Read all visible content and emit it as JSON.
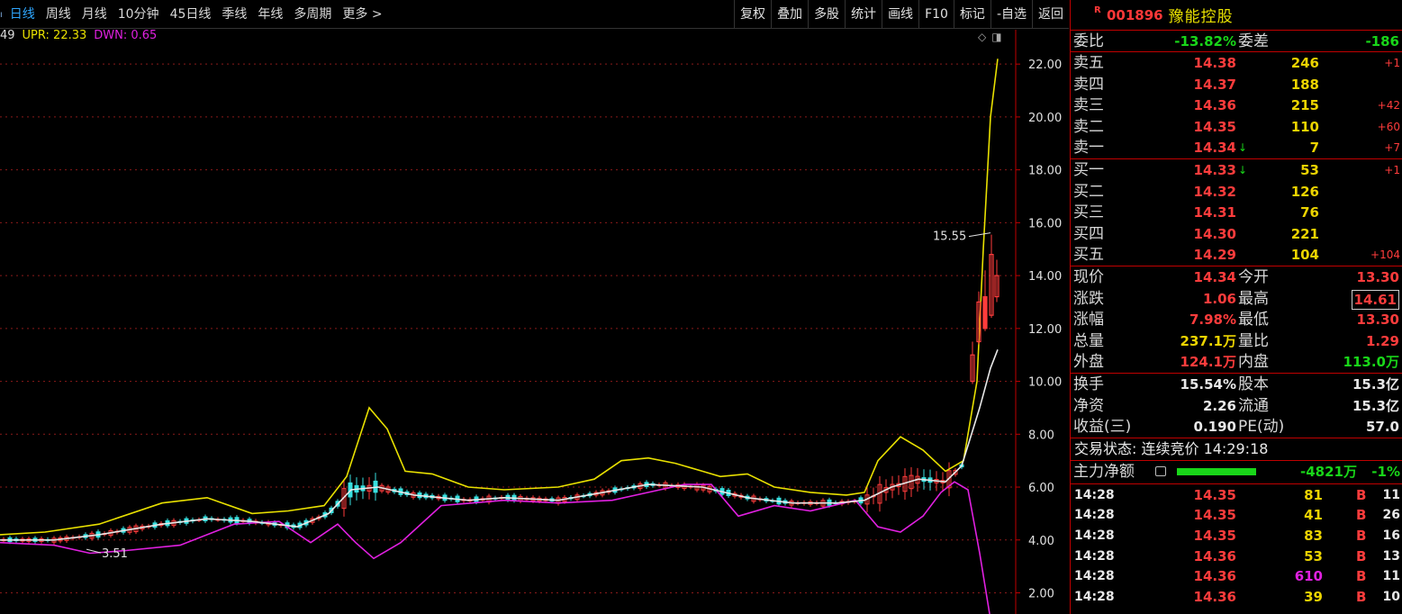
{
  "toolbar": {
    "edge_mark": "ו",
    "period_tabs": [
      {
        "label": "日线",
        "active": true
      },
      {
        "label": "周线",
        "active": false
      },
      {
        "label": "月线",
        "active": false
      },
      {
        "label": "10分钟",
        "active": false
      },
      {
        "label": "45日线",
        "active": false
      },
      {
        "label": "季线",
        "active": false
      },
      {
        "label": "年线",
        "active": false
      },
      {
        "label": "多周期",
        "active": false
      },
      {
        "label": "更多 >",
        "active": false
      }
    ],
    "buttons": [
      "复权",
      "叠加",
      "多股",
      "统计",
      "画线",
      "F10",
      "标记",
      "-自选",
      "返回"
    ]
  },
  "indicator": {
    "prefix": "49",
    "upr": "UPR: 22.33",
    "dwn": "DWN: 0.65",
    "ctrl_icons": [
      "diamond-icon",
      "window-icon"
    ]
  },
  "chart_data": {
    "type": "candlestick",
    "y_axis": {
      "ticks": [
        2.0,
        4.0,
        6.0,
        8.0,
        10.0,
        12.0,
        14.0,
        16.0,
        18.0,
        20.0,
        22.0
      ],
      "tick_labels": [
        "2.00",
        "4.00",
        "6.00",
        "8.00",
        "10.00",
        "12.00",
        "14.00",
        "16.00",
        "18.00",
        "20.00",
        "22.00"
      ],
      "range": [
        1.2,
        23.3
      ]
    },
    "grid": "dotted",
    "annotations": [
      {
        "label": "15.55",
        "value": 15.55,
        "kind": "high-marker"
      },
      {
        "label": "3.51",
        "value": 3.51,
        "kind": "low-marker"
      }
    ],
    "series": [
      {
        "name": "UPR",
        "color": "#e8e000",
        "values": [
          [
            0,
            4.2
          ],
          [
            50,
            4.3
          ],
          [
            110,
            4.6
          ],
          [
            180,
            5.4
          ],
          [
            230,
            5.6
          ],
          [
            280,
            5.0
          ],
          [
            320,
            5.1
          ],
          [
            360,
            5.3
          ],
          [
            385,
            6.4
          ],
          [
            410,
            9.0
          ],
          [
            430,
            8.2
          ],
          [
            450,
            6.6
          ],
          [
            480,
            6.5
          ],
          [
            520,
            6.0
          ],
          [
            560,
            5.9
          ],
          [
            620,
            6.0
          ],
          [
            660,
            6.3
          ],
          [
            690,
            7.0
          ],
          [
            720,
            7.1
          ],
          [
            750,
            6.9
          ],
          [
            780,
            6.6
          ],
          [
            800,
            6.4
          ],
          [
            830,
            6.5
          ],
          [
            860,
            6.0
          ],
          [
            900,
            5.8
          ],
          [
            940,
            5.7
          ],
          [
            960,
            5.8
          ],
          [
            975,
            7.0
          ],
          [
            1000,
            7.9
          ],
          [
            1025,
            7.4
          ],
          [
            1050,
            6.6
          ],
          [
            1070,
            7.0
          ],
          [
            1085,
            10.0
          ],
          [
            1092,
            15.0
          ],
          [
            1100,
            20.0
          ],
          [
            1108,
            22.2
          ]
        ]
      },
      {
        "name": "MID",
        "color": "#e8e8e8",
        "values": [
          [
            0,
            4.0
          ],
          [
            60,
            4.0
          ],
          [
            110,
            4.2
          ],
          [
            180,
            4.6
          ],
          [
            230,
            4.8
          ],
          [
            280,
            4.7
          ],
          [
            330,
            4.5
          ],
          [
            365,
            5.0
          ],
          [
            390,
            5.9
          ],
          [
            420,
            6.0
          ],
          [
            460,
            5.7
          ],
          [
            520,
            5.5
          ],
          [
            560,
            5.6
          ],
          [
            620,
            5.5
          ],
          [
            670,
            5.8
          ],
          [
            720,
            6.1
          ],
          [
            780,
            6.0
          ],
          [
            830,
            5.6
          ],
          [
            880,
            5.4
          ],
          [
            930,
            5.4
          ],
          [
            960,
            5.5
          ],
          [
            990,
            6.0
          ],
          [
            1020,
            6.3
          ],
          [
            1050,
            6.2
          ],
          [
            1068,
            6.8
          ],
          [
            1088,
            9.0
          ],
          [
            1100,
            10.5
          ],
          [
            1108,
            11.2
          ]
        ]
      },
      {
        "name": "DWN",
        "color": "#e020e0",
        "values": [
          [
            0,
            3.9
          ],
          [
            60,
            3.8
          ],
          [
            100,
            3.5
          ],
          [
            140,
            3.6
          ],
          [
            200,
            3.8
          ],
          [
            260,
            4.6
          ],
          [
            310,
            4.7
          ],
          [
            345,
            3.9
          ],
          [
            375,
            4.6
          ],
          [
            395,
            3.9
          ],
          [
            415,
            3.3
          ],
          [
            445,
            3.9
          ],
          [
            490,
            5.3
          ],
          [
            560,
            5.5
          ],
          [
            620,
            5.4
          ],
          [
            680,
            5.5
          ],
          [
            720,
            5.8
          ],
          [
            760,
            6.1
          ],
          [
            790,
            6.1
          ],
          [
            820,
            4.9
          ],
          [
            860,
            5.3
          ],
          [
            900,
            5.1
          ],
          [
            950,
            5.5
          ],
          [
            975,
            4.5
          ],
          [
            1000,
            4.3
          ],
          [
            1025,
            4.9
          ],
          [
            1045,
            5.8
          ],
          [
            1060,
            6.2
          ],
          [
            1075,
            5.9
          ],
          [
            1088,
            3.5
          ],
          [
            1100,
            1.0
          ]
        ]
      },
      {
        "name": "candles",
        "values": [
          {
            "x": 1080,
            "o": 10.0,
            "c": 11.0,
            "h": 11.5,
            "l": 9.9,
            "up": true
          },
          {
            "x": 1087,
            "o": 11.5,
            "c": 13.0,
            "h": 13.4,
            "l": 11.4,
            "up": true
          },
          {
            "x": 1094,
            "o": 13.2,
            "c": 12.0,
            "h": 14.2,
            "l": 11.9,
            "up": false
          },
          {
            "x": 1101,
            "o": 12.5,
            "c": 14.8,
            "h": 15.55,
            "l": 12.4,
            "up": true
          },
          {
            "x": 1107,
            "o": 14.0,
            "c": 13.2,
            "h": 14.6,
            "l": 13.0,
            "up": true
          }
        ]
      }
    ]
  },
  "panel": {
    "r_mark": "R",
    "code": "001896",
    "name": "豫能控股",
    "weibi": {
      "label": "委比",
      "value": "-13.82%",
      "label2": "委差",
      "value2": "-186"
    },
    "asks": [
      {
        "label": "卖五",
        "price": "14.38",
        "vol": "246",
        "chg": "+1"
      },
      {
        "label": "卖四",
        "price": "14.37",
        "vol": "188",
        "chg": ""
      },
      {
        "label": "卖三",
        "price": "14.36",
        "vol": "215",
        "chg": "+42"
      },
      {
        "label": "卖二",
        "price": "14.35",
        "vol": "110",
        "chg": "+60"
      },
      {
        "label": "卖一",
        "price": "14.34",
        "vol": "7",
        "chg": "+7",
        "arrow": "↓"
      }
    ],
    "bids": [
      {
        "label": "买一",
        "price": "14.33",
        "vol": "53",
        "chg": "+1",
        "arrow": "↓"
      },
      {
        "label": "买二",
        "price": "14.32",
        "vol": "126",
        "chg": ""
      },
      {
        "label": "买三",
        "price": "14.31",
        "vol": "76",
        "chg": ""
      },
      {
        "label": "买四",
        "price": "14.30",
        "vol": "221",
        "chg": ""
      },
      {
        "label": "买五",
        "price": "14.29",
        "vol": "104",
        "chg": "+104"
      }
    ],
    "quote1": [
      {
        "l1": "现价",
        "v1": "14.34",
        "c1": "red",
        "l2": "今开",
        "v2": "13.30",
        "c2": "red"
      },
      {
        "l1": "涨跌",
        "v1": "1.06",
        "c1": "red",
        "l2": "最高",
        "v2": "14.61",
        "c2": "red",
        "box2": true
      },
      {
        "l1": "涨幅",
        "v1": "7.98%",
        "c1": "red",
        "l2": "最低",
        "v2": "13.30",
        "c2": "red"
      },
      {
        "l1": "总量",
        "v1": "237.1万",
        "c1": "yellow",
        "l2": "量比",
        "v2": "1.29",
        "c2": "red"
      },
      {
        "l1": "外盘",
        "v1": "124.1万",
        "c1": "red",
        "l2": "内盘",
        "v2": "113.0万",
        "c2": "green"
      }
    ],
    "quote2": [
      {
        "l1": "换手",
        "v1": "15.54%",
        "c1": "white",
        "l2": "股本",
        "v2": "15.3亿",
        "c2": "white"
      },
      {
        "l1": "净资",
        "v1": "2.26",
        "c1": "white",
        "l2": "流通",
        "v2": "15.3亿",
        "c2": "white"
      },
      {
        "l1": "收益(三)",
        "v1": "0.190",
        "c1": "white",
        "l2": "PE(动)",
        "v2": "57.0",
        "c2": "white"
      }
    ],
    "status": "交易状态: 连续竞价 14:29:18",
    "main_force": {
      "label": "主力净额",
      "value": "-4821万",
      "pct": "-1%"
    },
    "ticks": [
      {
        "time": "14:28",
        "price": "14.35",
        "vol": "81",
        "vol_color": "yellow",
        "bs": "B",
        "count": "11"
      },
      {
        "time": "14:28",
        "price": "14.35",
        "vol": "41",
        "vol_color": "yellow",
        "bs": "B",
        "count": "26"
      },
      {
        "time": "14:28",
        "price": "14.35",
        "vol": "83",
        "vol_color": "yellow",
        "bs": "B",
        "count": "16"
      },
      {
        "time": "14:28",
        "price": "14.36",
        "vol": "53",
        "vol_color": "yellow",
        "bs": "B",
        "count": "13"
      },
      {
        "time": "14:28",
        "price": "14.36",
        "vol": "610",
        "vol_color": "magenta",
        "bs": "B",
        "count": "11"
      },
      {
        "time": "14:28",
        "price": "14.36",
        "vol": "39",
        "vol_color": "yellow",
        "bs": "B",
        "count": "10"
      }
    ]
  }
}
